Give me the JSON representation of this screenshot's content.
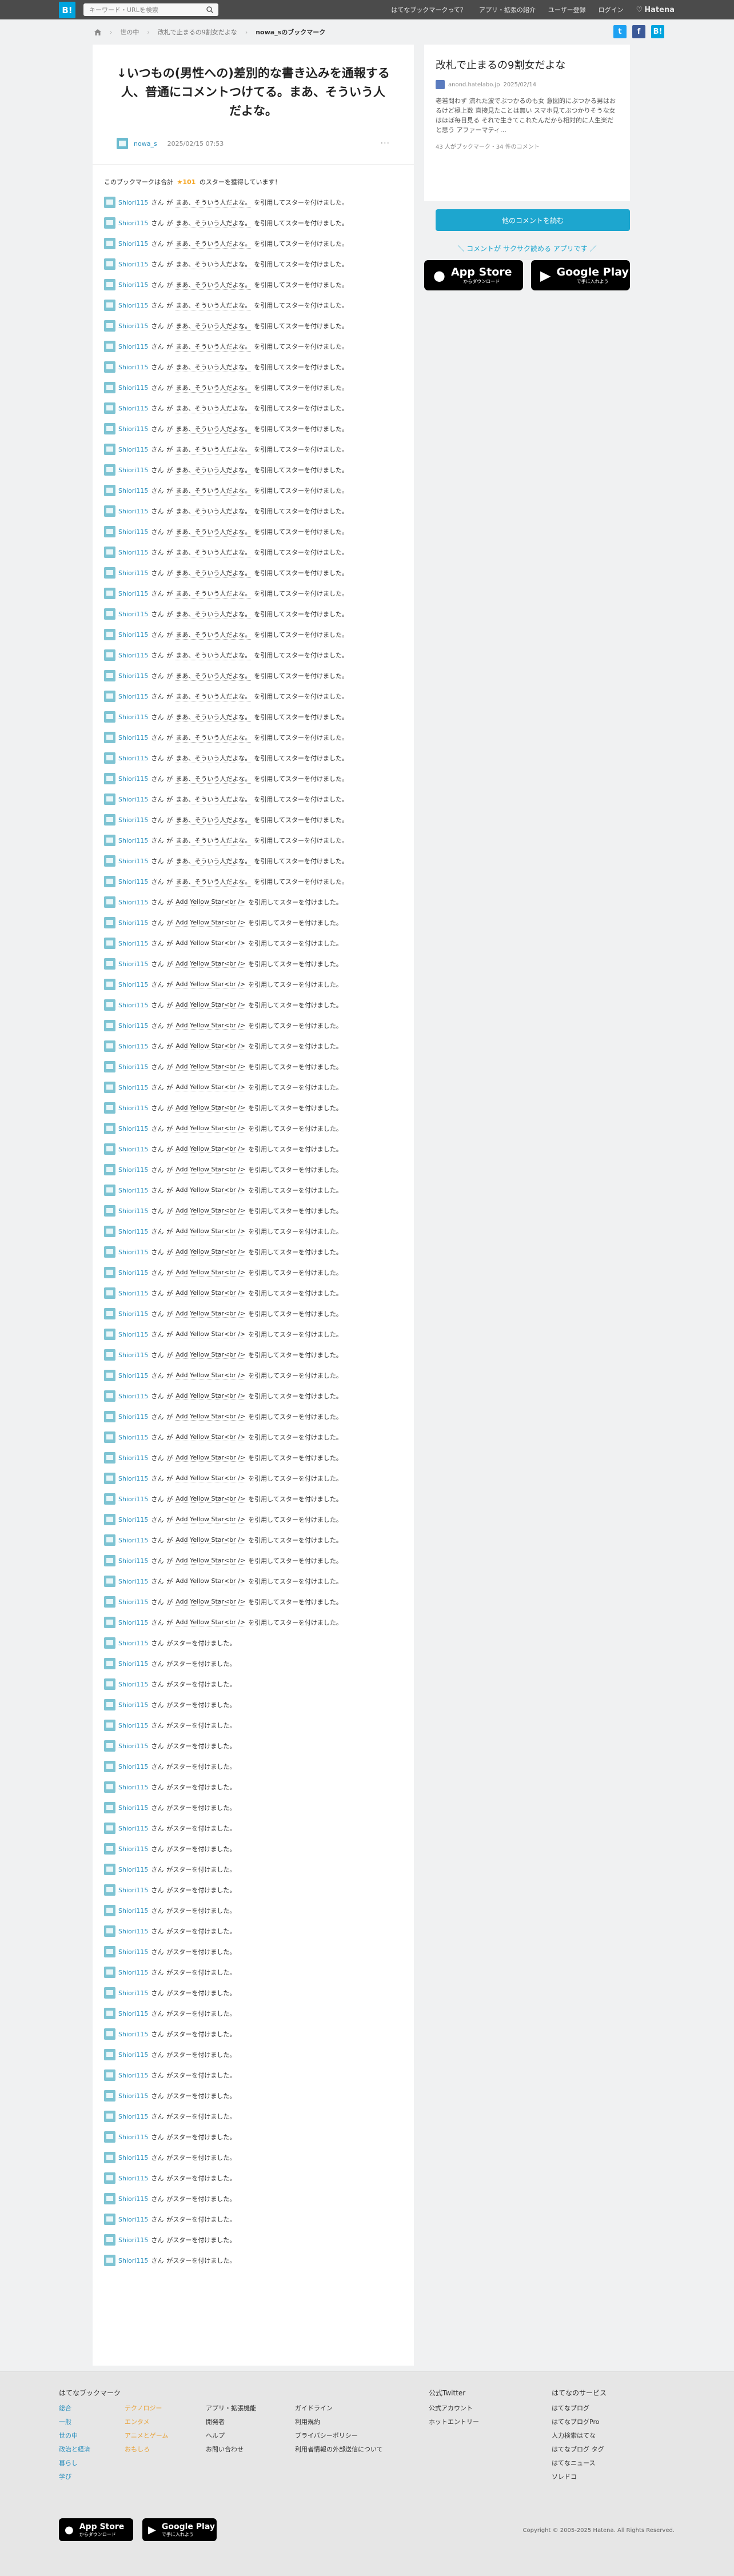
{
  "topbar": {
    "logo": "B!",
    "search_placeholder": "キーワード・URLを検索",
    "links": [
      "はてなブックマークって？",
      "アプリ・拡張の紹介",
      "ユーザー登録",
      "ログイン"
    ],
    "brand": "Hatena"
  },
  "breadcrumb": [
    "世の中",
    "改札で止まるの9割女だよな",
    "nowa_sのブックマーク"
  ],
  "share": {
    "twitter": "t",
    "facebook": "f",
    "hatena": "B!"
  },
  "entry": {
    "title": "↓いつもの(男性への)差別的な書き込みを通報する人、普通にコメントつけてる。まあ、そういう人だよな。",
    "user": "nowa_s",
    "date": "2025/02/15 07:53",
    "more": "···"
  },
  "stars": {
    "summary_prefix": "このブックマークは合計",
    "count_label": "★101",
    "summary_suffix": "のスターを獲得しています！",
    "user": "Shiori115",
    "san": "さん",
    "ga": "が",
    "quote_a": "まあ、そういう人だよな。",
    "quote_b": "Add Yellow Star<br />",
    "used_suffix": "を引用してスターを付けました。",
    "plain": "がスターを付けました。"
  },
  "sidebar": {
    "title": "改札で止まるの9割女だよな",
    "source": "anond.hatelabo.jp",
    "date": "2025/02/14",
    "desc": "老若問わず 流れた波でぶつかるのも女 意図的にぶつかる男はおるけど極上数 直接見たことは無い スマホ見てぶつかりそうな女はほぼ毎日見る それで生きてこれたんだから相対的に人生楽だと思う アファーマティ…",
    "stats": "43 人がブックマーク・34 件のコメント",
    "button": "他のコメントを読む",
    "promo": "＼ コメントが サクサク読める アプリです ／",
    "appstore": {
      "big": "App Store",
      "small": "からダウンロード"
    },
    "googleplay": {
      "big": "Google Play",
      "small": "で手に入れよう"
    }
  },
  "footer": {
    "heading": "はてなブックマーク",
    "cats1": [
      "総合",
      "一般",
      "世の中",
      "政治と経済",
      "暮らし",
      "学び"
    ],
    "cats2": [
      "テクノロジー",
      "エンタメ",
      "アニメとゲーム",
      "おもしろ"
    ],
    "links1": [
      "アプリ・拡張機能",
      "開発者",
      "ヘルプ",
      "お問い合わせ"
    ],
    "links2": [
      "ガイドライン",
      "利用規約",
      "プライバシーポリシー",
      "利用者情報の外部送信について"
    ],
    "twitter_heading": "公式Twitter",
    "twitter_links": [
      "公式アカウント",
      "ホットエントリー"
    ],
    "services_heading": "はてなのサービス",
    "services": [
      "はてなブログ",
      "はてなブログPro",
      "人力検索はてな",
      "はてなブログ タグ",
      "はてなニュース",
      "ソレドコ"
    ],
    "copyright": "Copyright © 2005-2025 Hatena. All Rights Reserved."
  }
}
